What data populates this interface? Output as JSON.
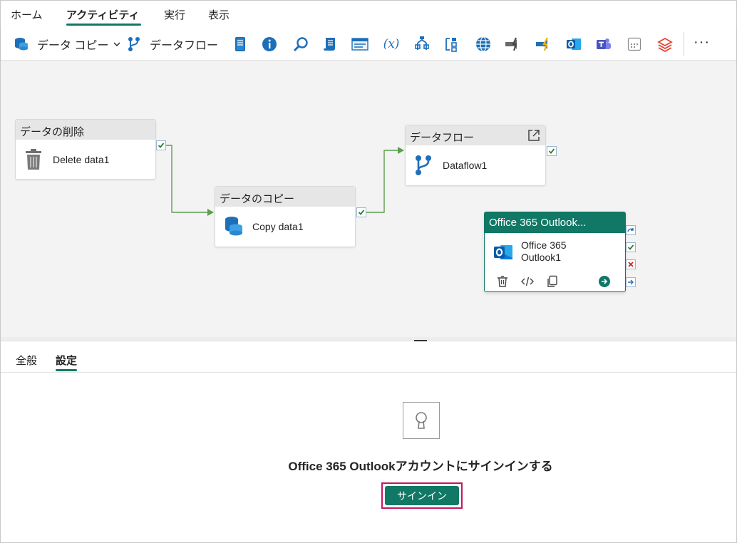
{
  "tabs": [
    "ホーム",
    "アクティビティ",
    "実行",
    "表示"
  ],
  "toolbar": {
    "copy_data_label": "データ コピー",
    "dataflow_label": "データフロー",
    "icons": [
      "notebook-icon",
      "info-icon",
      "lookup-icon",
      "script-icon",
      "stored-procedure-icon",
      "variable-icon",
      "if-condition-icon",
      "foreach-icon",
      "web-icon",
      "webhook-icon",
      "azure-function-icon",
      "outlook-icon",
      "teams-icon",
      "calendar-icon",
      "databricks-icon"
    ],
    "variable_glyph": "(x)",
    "more_label": "···"
  },
  "canvas": {
    "nodes": {
      "delete": {
        "header": "データの削除",
        "name": "Delete data1"
      },
      "copy": {
        "header": "データのコピー",
        "name": "Copy data1"
      },
      "dataflow": {
        "header": "データフロー",
        "name": "Dataflow1"
      },
      "outlook": {
        "header": "Office 365 Outlook...",
        "name_line1": "Office 365",
        "name_line2": "Outlook1"
      }
    },
    "colors": {
      "accent": "#117865",
      "edge": "#5b9e4d",
      "fail": "#c42b1c"
    }
  },
  "panel": {
    "tabs": [
      "全般",
      "設定"
    ],
    "signin_title": "Office 365 Outlookアカウントにサインインする",
    "signin_button": "サインイン"
  }
}
